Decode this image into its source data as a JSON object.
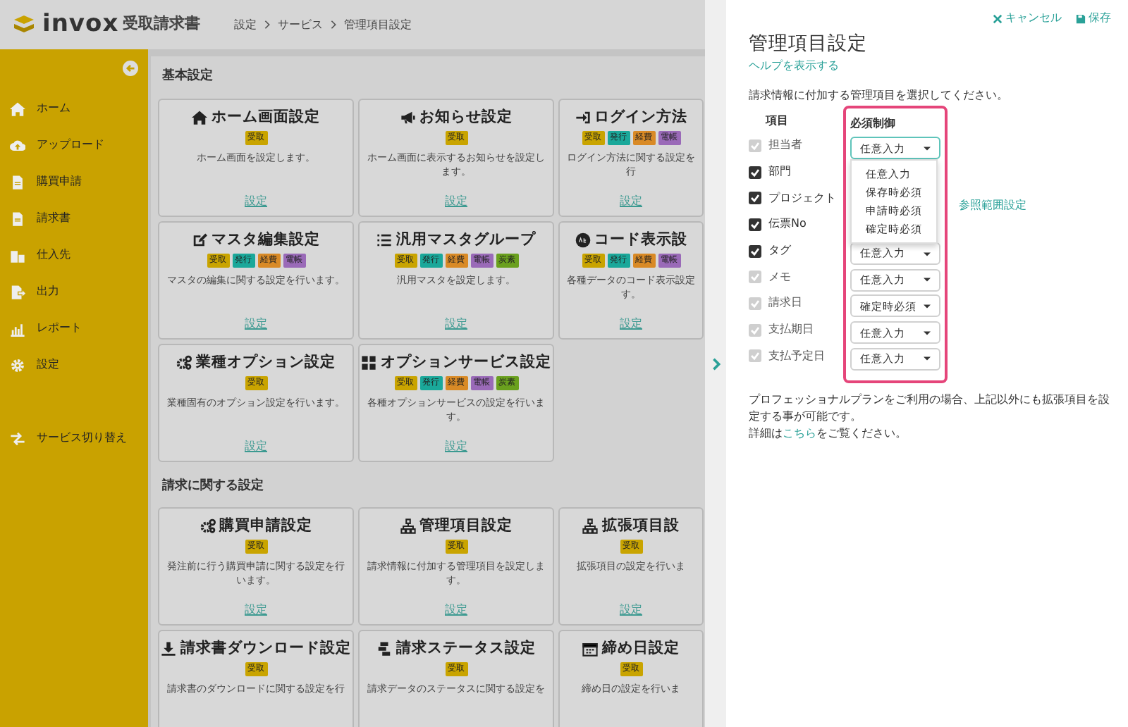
{
  "header": {
    "logo_text": "invox",
    "product": "受取請求書",
    "breadcrumb": [
      "設定",
      "サービス",
      "管理項目設定"
    ]
  },
  "sidebar": {
    "items": [
      {
        "label": "ホーム"
      },
      {
        "label": "アップロード"
      },
      {
        "label": "購買申請"
      },
      {
        "label": "請求書"
      },
      {
        "label": "仕入先"
      },
      {
        "label": "出力"
      },
      {
        "label": "レポート"
      },
      {
        "label": "設定"
      },
      {
        "label": "サービス切り替え"
      }
    ]
  },
  "sections": [
    {
      "title": "基本設定",
      "cards": [
        {
          "title": "ホーム画面設定",
          "badges": [
            {
              "label": "受取",
              "color": "#c9a400"
            }
          ],
          "description": "ホーム画面を設定します。",
          "link": "設定"
        },
        {
          "title": "お知らせ設定",
          "badges": [
            {
              "label": "受取",
              "color": "#c9a400"
            }
          ],
          "description": "ホーム画面に表示するお知らせを設定します。",
          "link": "設定"
        },
        {
          "title": "ログイン方法",
          "badges": [
            {
              "label": "受取",
              "color": "#c9a400"
            },
            {
              "label": "発行",
              "color": "#1aa89a"
            },
            {
              "label": "経費",
              "color": "#d98a26"
            },
            {
              "label": "電帳",
              "color": "#9a6ab8"
            }
          ],
          "description": "ログイン方法に関する設定を行",
          "link": "設定"
        },
        {
          "title": "マスタ編集設定",
          "badges": [
            {
              "label": "受取",
              "color": "#c9a400"
            },
            {
              "label": "発行",
              "color": "#1aa89a"
            },
            {
              "label": "経費",
              "color": "#d98a26"
            },
            {
              "label": "電帳",
              "color": "#9a6ab8"
            }
          ],
          "description": "マスタの編集に関する設定を行います。",
          "link": "設定"
        },
        {
          "title": "汎用マスタグループ",
          "badges": [
            {
              "label": "受取",
              "color": "#c9a400"
            },
            {
              "label": "発行",
              "color": "#1aa89a"
            },
            {
              "label": "経費",
              "color": "#d98a26"
            },
            {
              "label": "電帳",
              "color": "#9a6ab8"
            },
            {
              "label": "炭素",
              "color": "#6aa01e"
            }
          ],
          "description": "汎用マスタを設定します。",
          "link": "設定"
        },
        {
          "title": "コード表示設",
          "badges": [
            {
              "label": "受取",
              "color": "#c9a400"
            },
            {
              "label": "発行",
              "color": "#1aa89a"
            },
            {
              "label": "経費",
              "color": "#d98a26"
            },
            {
              "label": "電帳",
              "color": "#9a6ab8"
            }
          ],
          "description": "各種データのコード表示設定す。",
          "link": "設定"
        },
        {
          "title": "業種オプション設定",
          "badges": [
            {
              "label": "受取",
              "color": "#c9a400"
            }
          ],
          "description": "業種固有のオプション設定を行います。",
          "link": "設定"
        },
        {
          "title": "オプションサービス設定",
          "badges": [
            {
              "label": "受取",
              "color": "#c9a400"
            },
            {
              "label": "発行",
              "color": "#1aa89a"
            },
            {
              "label": "経費",
              "color": "#d98a26"
            },
            {
              "label": "電帳",
              "color": "#9a6ab8"
            },
            {
              "label": "炭素",
              "color": "#6aa01e"
            }
          ],
          "description": "各種オプションサービスの設定を行います。",
          "link": "設定"
        }
      ]
    },
    {
      "title": "請求に関する設定",
      "cards": [
        {
          "title": "購買申請設定",
          "badges": [
            {
              "label": "受取",
              "color": "#c9a400"
            }
          ],
          "description": "発注前に行う購買申請に関する設定を行います。",
          "link": "設定"
        },
        {
          "title": "管理項目設定",
          "badges": [
            {
              "label": "受取",
              "color": "#c9a400"
            }
          ],
          "description": "請求情報に付加する管理項目を設定します。",
          "link": "設定"
        },
        {
          "title": "拡張項目設",
          "badges": [
            {
              "label": "受取",
              "color": "#c9a400"
            }
          ],
          "description": "拡張項目の設定を行いま",
          "link": "設定"
        },
        {
          "title": "請求書ダウンロード設定",
          "badges": [
            {
              "label": "受取",
              "color": "#c9a400"
            }
          ],
          "description": "請求書のダウンロードに関する設定を行"
        },
        {
          "title": "請求ステータス設定",
          "badges": [
            {
              "label": "受取",
              "color": "#c9a400"
            }
          ],
          "description": "請求データのステータスに関する設定を"
        },
        {
          "title": "締め日設定",
          "badges": [
            {
              "label": "受取",
              "color": "#c9a400"
            }
          ],
          "description": "締め日の設定を行いま"
        }
      ]
    }
  ],
  "panel": {
    "cancel": "キャンセル",
    "save": "保存",
    "title": "管理項目設定",
    "help_link": "ヘルプを表示する",
    "instruction": "請求情報に付加する管理項目を選択してください。",
    "columns": [
      "項目",
      "必須制御"
    ],
    "items": [
      {
        "label": "担当者",
        "checked": true,
        "disabled": true,
        "requirement": "任意入力",
        "open": true
      },
      {
        "label": "部門",
        "checked": true,
        "disabled": false
      },
      {
        "label": "プロジェクト",
        "checked": true,
        "disabled": false,
        "link": "参照範囲設定"
      },
      {
        "label": "伝票No",
        "checked": true,
        "disabled": false
      },
      {
        "label": "タグ",
        "checked": true,
        "disabled": false,
        "requirement": "任意入力"
      },
      {
        "label": "メモ",
        "checked": true,
        "disabled": true,
        "requirement": "任意入力"
      },
      {
        "label": "請求日",
        "checked": true,
        "disabled": true,
        "requirement": "確定時必須"
      },
      {
        "label": "支払期日",
        "checked": true,
        "disabled": true,
        "requirement": "任意入力"
      },
      {
        "label": "支払予定日",
        "checked": true,
        "disabled": true,
        "requirement": "任意入力"
      }
    ],
    "dropdown_options": [
      "任意入力",
      "保存時必須",
      "申請時必須",
      "確定時必須"
    ],
    "note": "プロフェッショナルプランをご利用の場合、上記以外にも拡張項目を設定する事が可能です。",
    "detail": {
      "before": "詳細は",
      "link": "こちら",
      "after": "をご覧ください。"
    }
  }
}
